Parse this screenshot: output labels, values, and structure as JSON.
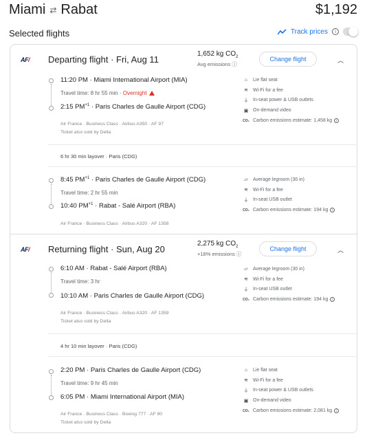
{
  "header": {
    "origin": "Miami",
    "destination": "Rabat",
    "swap_icon": "swap-arrows-icon",
    "price": "$1,192"
  },
  "selected": {
    "title": "Selected flights",
    "track_label": "Track prices",
    "track_enabled": false
  },
  "departing": {
    "airline_logo": "AF",
    "title": "Departing flight",
    "date": "Fri, Aug 11",
    "emissions": "1,652 kg CO",
    "emissions_sub": "2",
    "emissions_note": "Avg emissions",
    "change_label": "Change flight",
    "segments": [
      {
        "dep_time": "11:20 PM",
        "dep_airport": "Miami International Airport (MIA)",
        "travel_time": "Travel time: 8 hr 55 min",
        "overnight": "Overnight",
        "arr_time": "2:15 PM",
        "arr_plus": "+1",
        "arr_airport": "Paris Charles de Gaulle Airport (CDG)",
        "details": "Air France · Business Class · Airbus A350 · AF 97",
        "sold_by": "Ticket also sold by Delta",
        "amenities": [
          {
            "icon": "lie-flat-seat-icon",
            "glyph": "⌂",
            "text": "Lie flat seat"
          },
          {
            "icon": "wifi-icon",
            "glyph": "≋",
            "text": "Wi-Fi for a fee"
          },
          {
            "icon": "power-plug-icon",
            "glyph": "⏚",
            "text": "In-seat power & USB outlets"
          },
          {
            "icon": "video-icon",
            "glyph": "▣",
            "text": "On-demand video"
          },
          {
            "icon": "co2-icon",
            "glyph": "CO₂",
            "text": "Carbon emissions estimate: 1,458 kg"
          }
        ]
      },
      {
        "layover": "6 hr 30 min layover · Paris (CDG)",
        "dep_time": "8:45 PM",
        "dep_plus": "+1",
        "dep_airport": "Paris Charles de Gaulle Airport (CDG)",
        "travel_time": "Travel time: 2 hr 55 min",
        "arr_time": "10:40 PM",
        "arr_plus": "+1",
        "arr_airport": "Rabat - Salé Airport (RBA)",
        "details": "Air France · Business Class · Airbus A320 · AF 1358",
        "amenities": [
          {
            "icon": "legroom-icon",
            "glyph": "⏥",
            "text": "Average legroom (30 in)"
          },
          {
            "icon": "wifi-icon",
            "glyph": "≋",
            "text": "Wi-Fi for a fee"
          },
          {
            "icon": "usb-icon",
            "glyph": "⏚",
            "text": "In-seat USB outlet"
          },
          {
            "icon": "co2-icon",
            "glyph": "CO₂",
            "text": "Carbon emissions estimate: 194 kg"
          }
        ]
      }
    ]
  },
  "returning": {
    "airline_logo": "AF",
    "title": "Returning flight",
    "date": "Sun, Aug 20",
    "emissions": "2,275 kg CO",
    "emissions_sub": "2",
    "emissions_note": "+18% emissions",
    "change_label": "Change flight",
    "segments": [
      {
        "dep_time": "6:10 AM",
        "dep_airport": "Rabat - Salé Airport (RBA)",
        "travel_time": "Travel time: 3 hr",
        "arr_time": "10:10 AM",
        "arr_airport": "Paris Charles de Gaulle Airport (CDG)",
        "details": "Air France · Business Class · Airbus A320 · AF 1359",
        "sold_by": "Ticket also sold by Delta",
        "amenities": [
          {
            "icon": "legroom-icon",
            "glyph": "⏥",
            "text": "Average legroom (30 in)"
          },
          {
            "icon": "wifi-icon",
            "glyph": "≋",
            "text": "Wi-Fi for a fee"
          },
          {
            "icon": "usb-icon",
            "glyph": "⏚",
            "text": "In-seat USB outlet"
          },
          {
            "icon": "co2-icon",
            "glyph": "CO₂",
            "text": "Carbon emissions estimate: 194 kg"
          }
        ]
      },
      {
        "layover": "4 hr 10 min layover · Paris (CDG)",
        "dep_time": "2:20 PM",
        "dep_airport": "Paris Charles de Gaulle Airport (CDG)",
        "travel_time": "Travel time: 9 hr 45 min",
        "arr_time": "6:05 PM",
        "arr_airport": "Miami International Airport (MIA)",
        "details": "Air France · Business Class · Boeing 777 · AF 90",
        "sold_by": "Ticket also sold by Delta",
        "amenities": [
          {
            "icon": "lie-flat-seat-icon",
            "glyph": "⌂",
            "text": "Lie flat seat"
          },
          {
            "icon": "wifi-icon",
            "glyph": "≋",
            "text": "Wi-Fi for a fee"
          },
          {
            "icon": "power-plug-icon",
            "glyph": "⏚",
            "text": "In-seat power & USB outlets"
          },
          {
            "icon": "video-icon",
            "glyph": "▣",
            "text": "On-demand video"
          },
          {
            "icon": "co2-icon",
            "glyph": "CO₂",
            "text": "Carbon emissions estimate: 2,081 kg"
          }
        ]
      }
    ]
  },
  "colors": {
    "accent": "#1a73e8",
    "warning": "#d93025",
    "border": "#dadce0"
  }
}
